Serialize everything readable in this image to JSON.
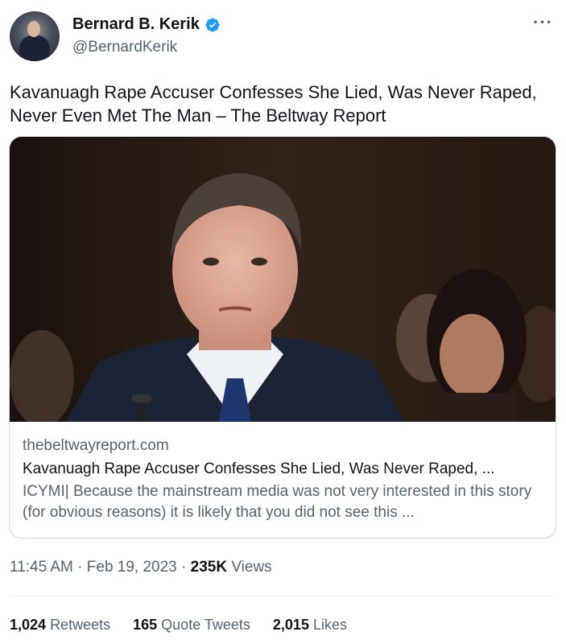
{
  "author": {
    "name": "Bernard B. Kerik",
    "handle": "@BernardKerik"
  },
  "icons": {
    "verified": "verified-badge-icon",
    "more": "more-options-icon"
  },
  "colors": {
    "text": "#0f1419",
    "secondary": "#536471",
    "verified": "#1d9bf0",
    "border": "#cfd9de"
  },
  "tweet": {
    "text": "Kavanuagh Rape Accuser Confesses She Lied, Was Never Raped, Never Even Met The Man – The Beltway Report"
  },
  "link_card": {
    "domain": "thebeltwayreport.com",
    "title": "Kavanuagh Rape Accuser Confesses She Lied, Was Never Raped, ...",
    "description": "ICYMI| Because the mainstream media was not very interested in this story (for obvious reasons) it is likely that you did not see this ..."
  },
  "meta": {
    "time": "11:45 AM",
    "date": "Feb 19, 2023",
    "views_count": "235K",
    "views_label": "Views"
  },
  "stats": {
    "retweets_count": "1,024",
    "retweets_label": "Retweets",
    "quotes_count": "165",
    "quotes_label": "Quote Tweets",
    "likes_count": "2,015",
    "likes_label": "Likes"
  }
}
